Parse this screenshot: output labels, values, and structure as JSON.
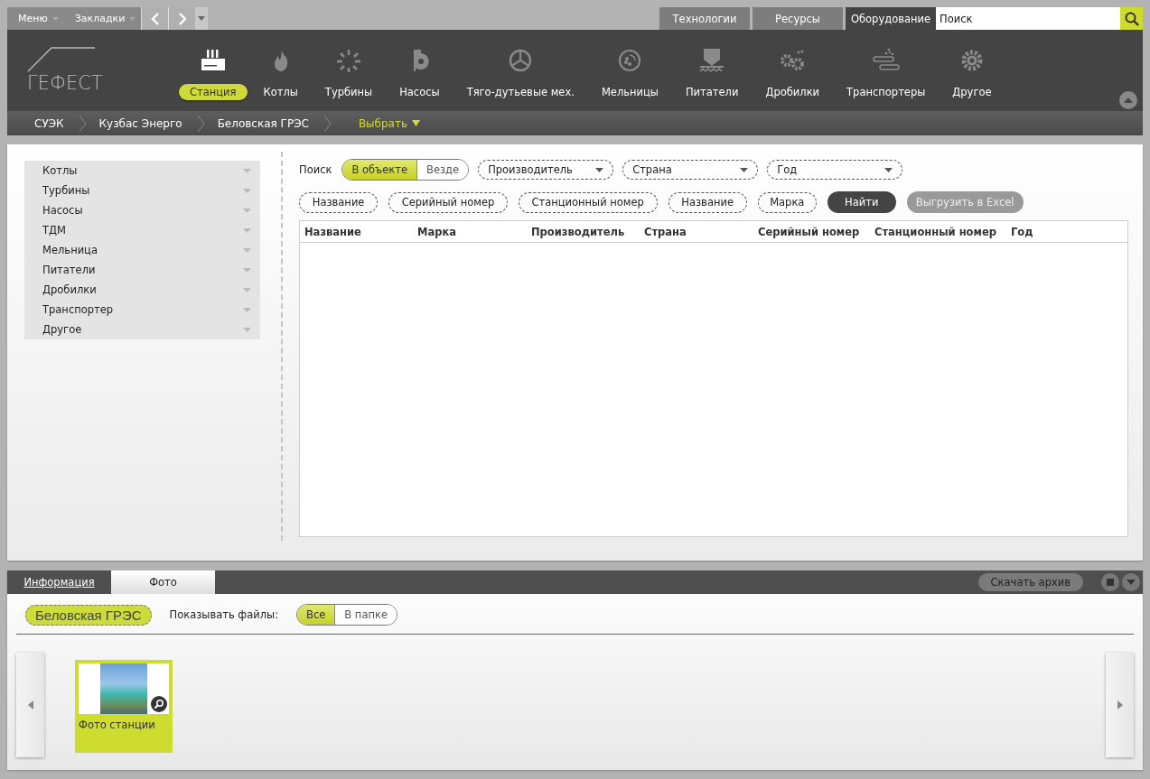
{
  "top_menu": [
    {
      "label": "Меню"
    },
    {
      "label": "Закладки"
    }
  ],
  "sections": [
    {
      "label": "Технологии",
      "selected": false
    },
    {
      "label": "Ресурсы",
      "selected": false
    },
    {
      "label": "Оборудование",
      "selected": true
    }
  ],
  "search": {
    "placeholder": "Поиск"
  },
  "logo": {
    "text": "ГЕФЕСТ"
  },
  "categories": [
    {
      "label": "Станция",
      "kind": "station",
      "selected": true
    },
    {
      "label": "Котлы",
      "kind": "flame",
      "selected": false
    },
    {
      "label": "Турбины",
      "kind": "fan",
      "selected": false
    },
    {
      "label": "Насосы",
      "kind": "pump",
      "selected": false
    },
    {
      "label": "Тяго-дутьевые мех.",
      "kind": "propeller",
      "selected": false
    },
    {
      "label": "Мельницы",
      "kind": "mill",
      "selected": false
    },
    {
      "label": "Питатели",
      "kind": "hopper",
      "selected": false
    },
    {
      "label": "Дробилки",
      "kind": "gears",
      "selected": false
    },
    {
      "label": "Транспортеры",
      "kind": "conveyor",
      "selected": false
    },
    {
      "label": "Другое",
      "kind": "gear",
      "selected": false
    }
  ],
  "breadcrumbs": [
    "СУЭК",
    "Кузбас Энерго",
    "Беловская ГРЭС"
  ],
  "breadcrumb_select": "Выбрать",
  "sidebar": {
    "items": [
      {
        "label": "Котлы",
        "expanded": false
      },
      {
        "label": "Турбины",
        "expanded": false
      },
      {
        "label": "Насосы",
        "expanded": false
      },
      {
        "label": "ТДМ",
        "expanded": false
      },
      {
        "label": "Мельница",
        "expanded": false
      },
      {
        "label": "Питатели",
        "expanded": false
      },
      {
        "label": "Дробилки",
        "expanded": false
      },
      {
        "label": "Транспортер",
        "expanded": false
      },
      {
        "label": "Другое",
        "expanded": false
      }
    ]
  },
  "search_panel": {
    "label": "Поиск",
    "scope": [
      {
        "label": "В объекте",
        "selected": true
      },
      {
        "label": "Везде",
        "selected": false
      }
    ],
    "dropdowns": [
      "Производитель",
      "Страна",
      "Год"
    ],
    "fields": [
      {
        "placeholder": "Название"
      },
      {
        "placeholder": "Серийный номер"
      },
      {
        "placeholder": "Станционный номер"
      },
      {
        "placeholder": "Название"
      },
      {
        "placeholder": "Марка"
      }
    ],
    "find_button": "Найти",
    "export_button": {
      "label": "Выгрузить в Excel",
      "disabled": true
    }
  },
  "table": {
    "columns": [
      "Название",
      "Марка",
      "Производитель",
      "Страна",
      "Серийный номер",
      "Станционный номер",
      "Год"
    ]
  },
  "bottom": {
    "tabs": [
      {
        "label": "Информация",
        "selected": false
      },
      {
        "label": "Фото",
        "selected": true
      }
    ],
    "download_button": "Скачать архив",
    "object_tag": "Беловская ГРЭС",
    "files_label": "Показывать файлы:",
    "file_filter": [
      {
        "label": "Все",
        "selected": true
      },
      {
        "label": "В папке",
        "selected": false
      }
    ],
    "photos": [
      {
        "caption": "Фото станции",
        "selected": true
      }
    ]
  }
}
